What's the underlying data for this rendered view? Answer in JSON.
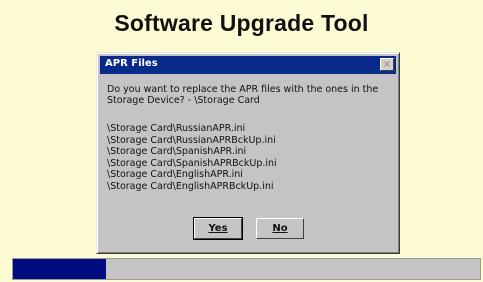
{
  "app": {
    "title": "Software Upgrade Tool"
  },
  "dialog": {
    "title": "APR Files",
    "close_symbol": "×",
    "message": "Do you want to replace the APR files with the ones in the Storage Device? - \\Storage Card",
    "files": [
      "\\Storage Card\\RussianAPR.ini",
      "\\Storage Card\\RussianAPRBckUp.ini",
      "\\Storage Card\\SpanishAPR.ini",
      "\\Storage Card\\SpanishAPRBckUp.ini",
      "\\Storage Card\\EnglishAPR.ini",
      "\\Storage Card\\EnglishAPRBckUp.ini"
    ],
    "buttons": {
      "yes": "Yes",
      "no": "No"
    }
  },
  "progress": {
    "fraction": 0.2,
    "fill_color": "#000c7f"
  },
  "colors": {
    "background": "#fdfbd3",
    "titlebar": "#0a2a8a"
  }
}
